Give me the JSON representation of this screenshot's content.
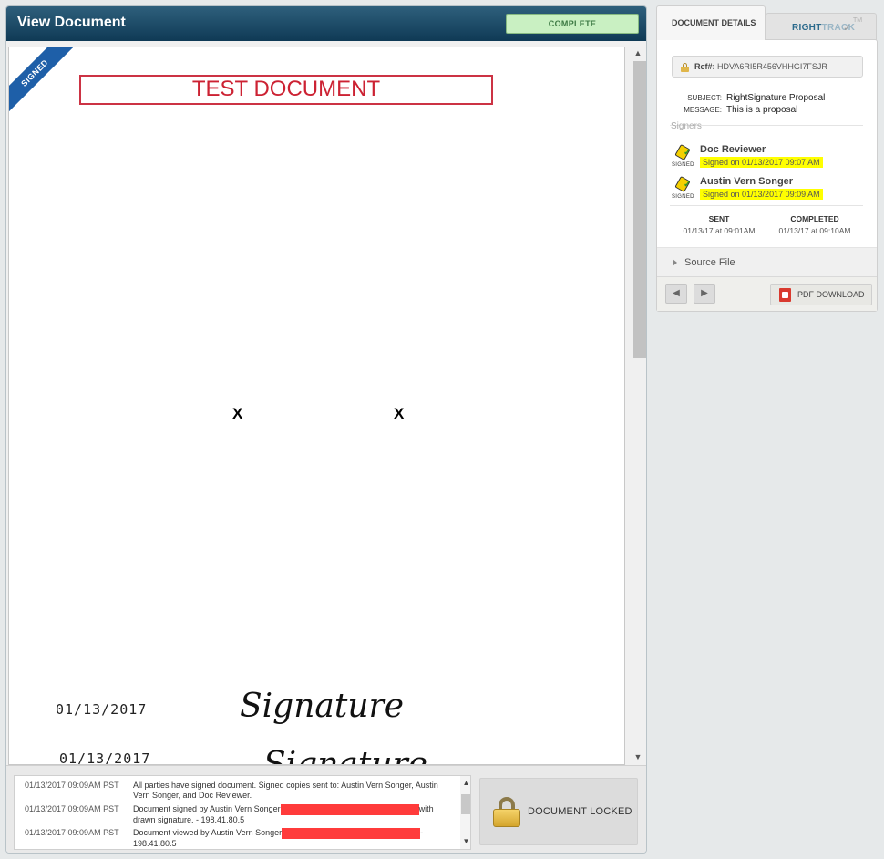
{
  "main": {
    "title": "View Document",
    "status": "COMPLETE",
    "document": {
      "ribbon": "SIGNED",
      "heading": "TEST DOCUMENT",
      "sig_markers": [
        "X",
        "X"
      ],
      "dates": [
        "01/13/2017",
        "01/13/2017"
      ],
      "signatures": [
        "Signature",
        "Signature"
      ]
    }
  },
  "log": {
    "entries": [
      {
        "time": "01/13/2017 09:09AM PST",
        "text_before": "All parties have signed document. Signed copies sent to: Austin Vern Songer, Austin Vern Songer, and Doc Reviewer.",
        "text_after": ""
      },
      {
        "time": "01/13/2017 09:09AM PST",
        "text_before": "Document signed by Austin Vern Songer",
        "text_after": "with drawn signature. - 198.41.80.5"
      },
      {
        "time": "01/13/2017 09:09AM PST",
        "text_before": "Document viewed by Austin Vern Songer",
        "text_after": "- 198.41.80.5"
      }
    ]
  },
  "locked_button": {
    "label": "DOCUMENT LOCKED"
  },
  "side": {
    "tabs": {
      "details": "DOCUMENT DETAILS",
      "righttrack_a": "RIGHT",
      "righttrack_b": "TRACK",
      "tm": "TM"
    },
    "ref": {
      "label": "Ref#:",
      "value": "HDVA6RI5R456VHHGI7FSJR"
    },
    "subject": {
      "label": "SUBJECT:",
      "value": "RightSignature Proposal"
    },
    "message": {
      "label": "MESSAGE:",
      "value": "This is a proposal"
    },
    "signers_heading": "Signers",
    "signers": [
      {
        "name": "Doc Reviewer",
        "date": "Signed on 01/13/2017 09:07 AM",
        "tag": "SIGNED"
      },
      {
        "name": "Austin Vern Songer",
        "date": "Signed on 01/13/2017 09:09 AM",
        "tag": "SIGNED"
      }
    ],
    "sent": {
      "label": "SENT",
      "value": "01/13/17 at 09:01AM"
    },
    "completed": {
      "label": "COMPLETED",
      "value": "01/13/17 at 09:10AM"
    },
    "source_file": "Source File",
    "pdf_download": "PDF DOWNLOAD"
  },
  "colors": {
    "header": "#0f3a55",
    "status_bg": "#c9f0c2",
    "redaction": "#ff3b3b",
    "highlight": "#ffff00"
  }
}
